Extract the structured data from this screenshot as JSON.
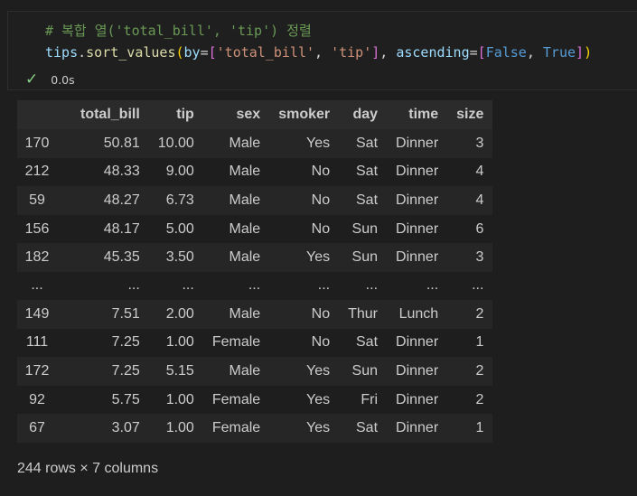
{
  "cell": {
    "comment": "# 복합 열('total_bill', 'tip') 정렬",
    "code": {
      "obj": "tips",
      "dot": ".",
      "method": "sort_values",
      "open_paren": "(",
      "by_kw": "by",
      "eq1": "=",
      "open_bracket": "[",
      "str1": "'total_bill'",
      "comma1": ", ",
      "str2": "'tip'",
      "close_bracket": "]",
      "comma2": ", ",
      "asc_kw": "ascending",
      "eq2": "=",
      "open_bracket2": "[",
      "false_val": "False",
      "comma3": ", ",
      "true_val": "True",
      "close_bracket2": "]",
      "close_paren": ")"
    },
    "status_icon": "check-icon",
    "exec_time": "0.0s"
  },
  "table": {
    "columns": [
      "",
      "total_bill",
      "tip",
      "sex",
      "smoker",
      "day",
      "time",
      "size"
    ],
    "rows": [
      [
        "170",
        "50.81",
        "10.00",
        "Male",
        "Yes",
        "Sat",
        "Dinner",
        "3"
      ],
      [
        "212",
        "48.33",
        "9.00",
        "Male",
        "No",
        "Sat",
        "Dinner",
        "4"
      ],
      [
        "59",
        "48.27",
        "6.73",
        "Male",
        "No",
        "Sat",
        "Dinner",
        "4"
      ],
      [
        "156",
        "48.17",
        "5.00",
        "Male",
        "No",
        "Sun",
        "Dinner",
        "6"
      ],
      [
        "182",
        "45.35",
        "3.50",
        "Male",
        "Yes",
        "Sun",
        "Dinner",
        "3"
      ],
      [
        "...",
        "...",
        "...",
        "...",
        "...",
        "...",
        "...",
        "..."
      ],
      [
        "149",
        "7.51",
        "2.00",
        "Male",
        "No",
        "Thur",
        "Lunch",
        "2"
      ],
      [
        "111",
        "7.25",
        "1.00",
        "Female",
        "No",
        "Sat",
        "Dinner",
        "1"
      ],
      [
        "172",
        "7.25",
        "5.15",
        "Male",
        "Yes",
        "Sun",
        "Dinner",
        "2"
      ],
      [
        "92",
        "5.75",
        "1.00",
        "Female",
        "Yes",
        "Fri",
        "Dinner",
        "2"
      ],
      [
        "67",
        "3.07",
        "1.00",
        "Female",
        "Yes",
        "Sat",
        "Dinner",
        "1"
      ]
    ]
  },
  "shape_text": "244 rows × 7 columns"
}
